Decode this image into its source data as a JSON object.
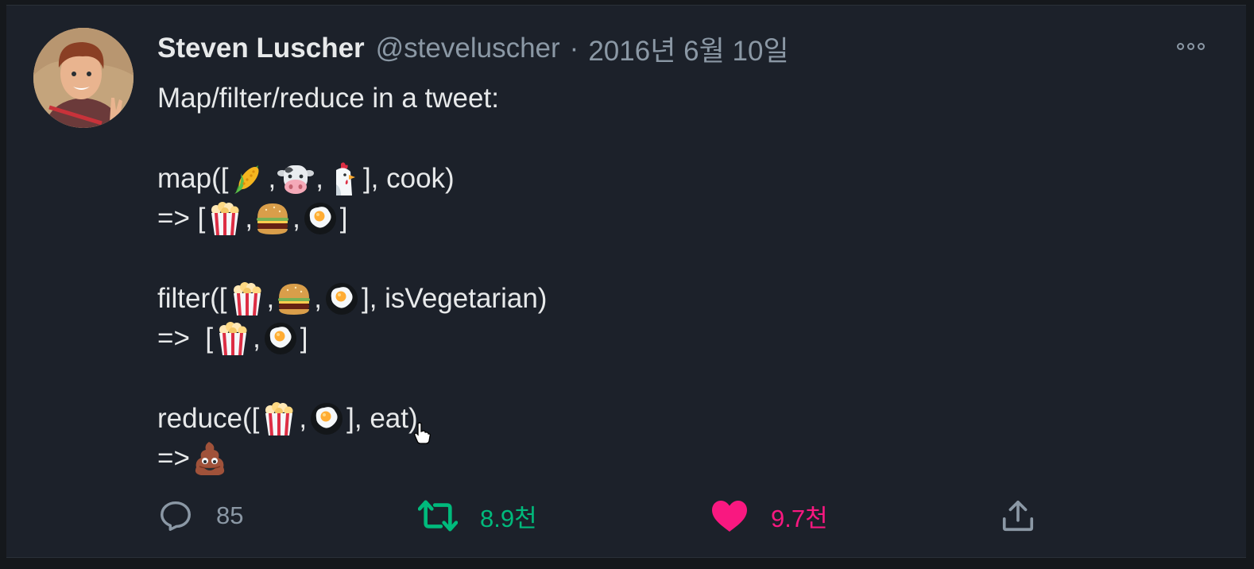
{
  "tweet": {
    "author_name": "Steven Luscher",
    "author_handle": "@steveluscher",
    "separator": "·",
    "date": "2016년 6월 10일",
    "lines": {
      "intro": "Map/filter/reduce in a tweet:",
      "map_prefix": "map([",
      "map_suffix": "], cook)",
      "map_result_prefix": "=> [",
      "filter_prefix": "filter([",
      "filter_suffix": "], isVegetarian)",
      "filter_result_prefix": "=>  [",
      "reduce_prefix": "reduce([",
      "reduce_suffix": "], eat)",
      "reduce_result_prefix": "=>",
      "comma": ",",
      "close_bracket": "]"
    },
    "emoji": [
      "corn-emoji",
      "cow-emoji",
      "chicken-emoji",
      "popcorn-emoji",
      "hamburger-emoji",
      "fried-egg-emoji",
      "poop-emoji"
    ]
  },
  "actions": {
    "reply_count": "85",
    "retweet_count": "8.9천",
    "like_count": "9.7천"
  },
  "colors": {
    "background": "#1c212a",
    "text": "#e7e9ea",
    "muted": "#8b98a5",
    "retweet_green": "#00ba7c",
    "like_pink": "#f91880"
  },
  "icons": [
    "reply-icon",
    "retweet-icon",
    "heart-icon",
    "share-icon",
    "more-icon"
  ]
}
